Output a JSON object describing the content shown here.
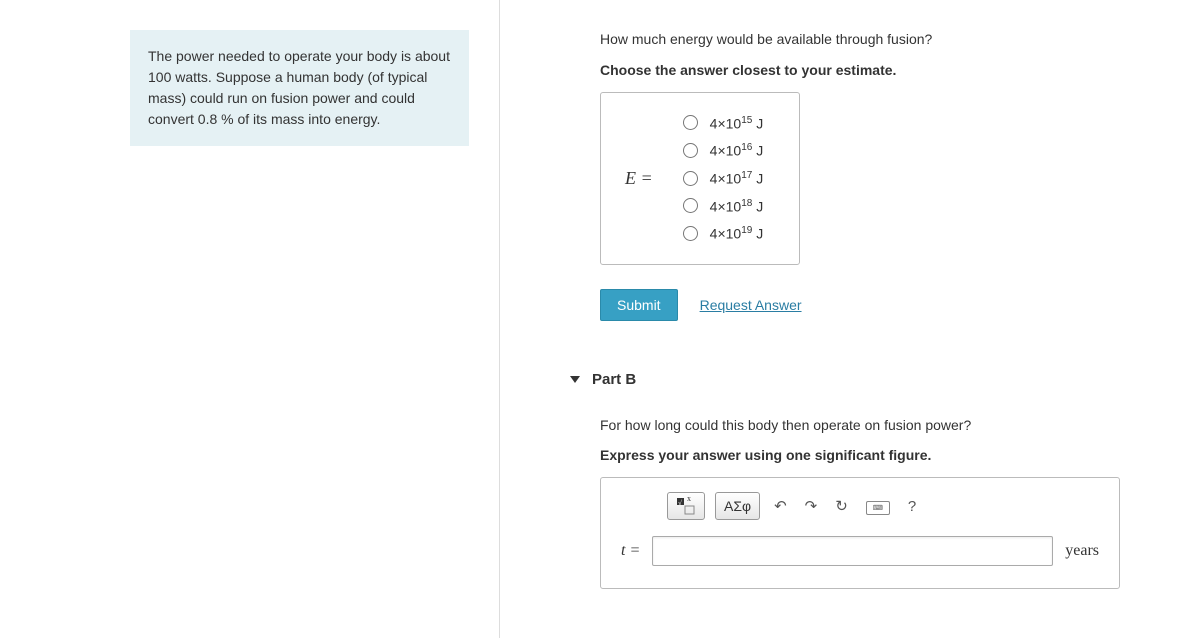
{
  "left": {
    "info": "The power needed to operate your body is about 100 watts. Suppose a human body (of typical mass) could run on fusion power and could convert 0.8 % of its mass into energy."
  },
  "partA": {
    "question": "How much energy would be available through fusion?",
    "instruction": "Choose the answer closest to your estimate.",
    "equals": "E =",
    "options": [
      {
        "coeff": "4×10",
        "exp": "15",
        "unit": " J"
      },
      {
        "coeff": "4×10",
        "exp": "16",
        "unit": " J"
      },
      {
        "coeff": "4×10",
        "exp": "17",
        "unit": " J"
      },
      {
        "coeff": "4×10",
        "exp": "18",
        "unit": " J"
      },
      {
        "coeff": "4×10",
        "exp": "19",
        "unit": " J"
      }
    ],
    "submit": "Submit",
    "request": "Request Answer"
  },
  "partB": {
    "title": "Part B",
    "question": "For how long could this body then operate on fusion power?",
    "instruction": "Express your answer using one significant figure.",
    "toolbar": {
      "greek": "ΑΣφ",
      "help": "?"
    },
    "input_label": "t =",
    "input_value": "",
    "unit": "years"
  }
}
